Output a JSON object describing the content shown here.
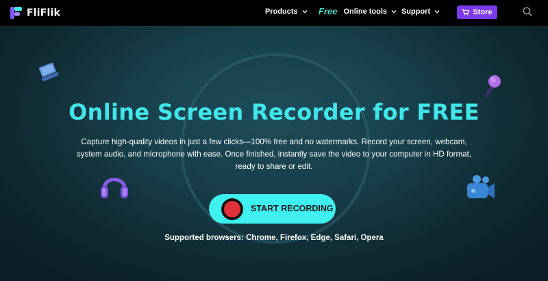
{
  "nav": {
    "brand": "FliFlik",
    "products_label": "Products",
    "free_label": "Free",
    "online_tools_label": "Online tools",
    "support_label": "Support",
    "store_label": "Store"
  },
  "hero": {
    "headline": "Online Screen Recorder for FREE",
    "subtitle": "Capture high-quality videos in just a few clicks—100% free and no watermarks. Record your screen, webcam, system audio, and microphone with ease. Once finished, instantly save the video to your computer in HD format, ready to share or edit.",
    "cta_label": "START RECORDING",
    "browsers": "Supported browsers: Chrome, Firefox, Edge, Safari, Opera"
  },
  "colors": {
    "accent_cyan": "#3fe6ea",
    "store_purple": "#7c3aed",
    "free_teal": "#3fe0c8",
    "record_red": "#e0303a"
  },
  "icons": {
    "logo": "fliflik-logo-icon",
    "cart": "cart-icon",
    "search": "search-icon",
    "laptop": "laptop-icon",
    "microphone": "microphone-icon",
    "headphones": "headphones-icon",
    "camera": "video-camera-icon"
  }
}
